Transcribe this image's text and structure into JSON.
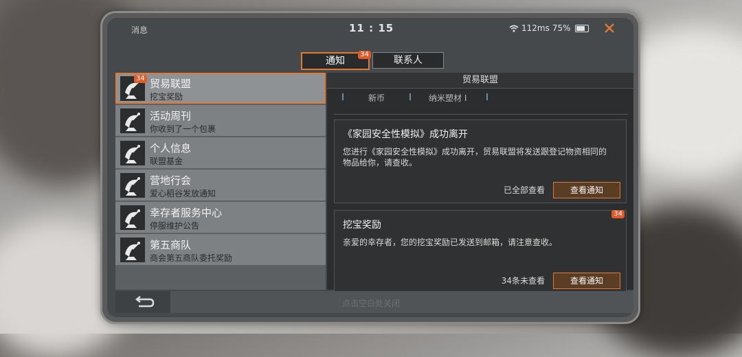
{
  "status_bar": {
    "left_label": "消息",
    "time": "11 : 15",
    "ping": "112ms",
    "battery_percent": "75%",
    "battery_level": 0.75
  },
  "tabs": [
    {
      "label": "通知",
      "badge": "34",
      "active": true
    },
    {
      "label": "联系人",
      "active": false
    }
  ],
  "sender_list": [
    {
      "title": "贸易联盟",
      "subtitle": "挖宝奖励",
      "badge": "34",
      "selected": true
    },
    {
      "title": "活动周刊",
      "subtitle": "你收到了一个包裹"
    },
    {
      "title": "个人信息",
      "subtitle": "联盟基金"
    },
    {
      "title": "营地行会",
      "subtitle": "爱心稻谷发放通知"
    },
    {
      "title": "幸存者服务中心",
      "subtitle": "停服维护公告"
    },
    {
      "title": "第五商队",
      "subtitle": "商会第五商队委托奖励"
    }
  ],
  "panel": {
    "header": "贸易联盟",
    "prev_strip": [
      "新币",
      "纳米塑材 I"
    ],
    "messages": [
      {
        "title": "《家园安全性模拟》成功离开",
        "body": "您进行《家园安全性模拟》成功离开，贸易联盟将发送跟登记物资相同的物品给你，请查收。",
        "status": "已全部查看",
        "button": "查看通知"
      },
      {
        "title": "挖宝奖励",
        "body": "亲爱的幸存者，您的挖宝奖励已发送到邮箱，请注意查收。",
        "status": "34条未查看",
        "button": "查看通知",
        "badge": "34"
      }
    ]
  },
  "bottom_bar": {
    "hint": "点击空白处关闭"
  },
  "colors": {
    "accent": "#e07a35",
    "badge": "#e05a2a"
  },
  "icons": {
    "list_item_icon": "satellite-dish-icon",
    "close": "close-icon",
    "back": "back-arrow-icon",
    "wifi": "wifi-icon",
    "battery": "battery-icon"
  }
}
